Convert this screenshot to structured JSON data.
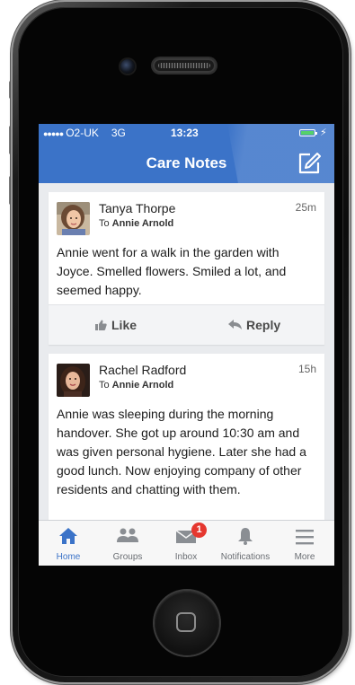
{
  "status_bar": {
    "signal": "●●●●●",
    "carrier": "O2-UK",
    "network": "3G",
    "time": "13:23",
    "charge_glyph": "⚡"
  },
  "nav": {
    "title": "Care Notes",
    "compose_icon": "compose-icon"
  },
  "posts": [
    {
      "author": "Tanya Thorpe",
      "to_prefix": "To",
      "to_name": "Annie Arnold",
      "time": "25m",
      "text": "Annie went for a walk in the garden with Joyce. Smelled flowers. Smiled a lot, and seemed happy.",
      "like_label": "Like",
      "reply_label": "Reply"
    },
    {
      "author": "Rachel Radford",
      "to_prefix": "To",
      "to_name": "Annie Arnold",
      "time": "15h",
      "text": "Annie was sleeping during the morning handover. She got up around 10:30 am and was given personal hygiene. Later she had a good lunch. Now enjoying company of other residents and chatting with them."
    }
  ],
  "tabs": [
    {
      "label": "Home",
      "icon": "home-icon",
      "active": true
    },
    {
      "label": "Groups",
      "icon": "groups-icon"
    },
    {
      "label": "Inbox",
      "icon": "inbox-icon",
      "badge": "1"
    },
    {
      "label": "Notifications",
      "icon": "bell-icon"
    },
    {
      "label": "More",
      "icon": "menu-icon"
    }
  ],
  "colors": {
    "accent": "#3b73c8",
    "badge": "#e5372f",
    "screen_bg": "#e9ebee"
  }
}
